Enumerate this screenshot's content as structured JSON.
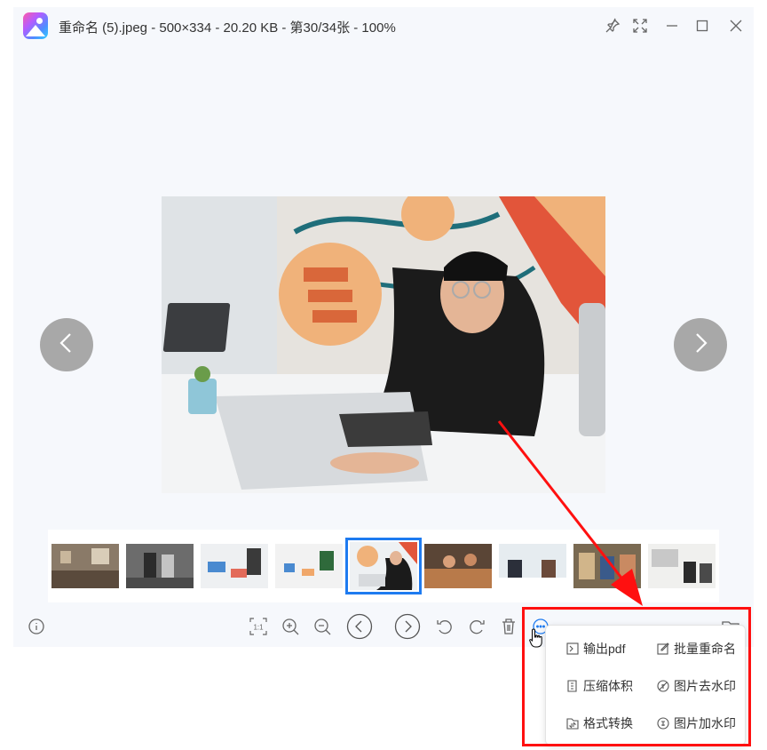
{
  "window": {
    "title": "重命名 (5).jpeg - 500×334 - 20.20 KB - 第30/34张 - 100%",
    "title_icons": [
      "pin-icon",
      "fullscreen-icon",
      "minimize-icon",
      "maximize-icon",
      "close-icon"
    ]
  },
  "viewer": {
    "prev_icon": "chevron-left-icon",
    "next_icon": "chevron-right-icon"
  },
  "thumbnails": {
    "count": 9,
    "selected_index": 4
  },
  "toolbar": {
    "icons": [
      "info-icon",
      "actual-size-icon",
      "zoom-in-icon",
      "zoom-out-icon",
      "previous-icon",
      "next-icon",
      "rotate-left-icon",
      "rotate-right-icon",
      "delete-icon",
      "more-icon",
      "folder-icon"
    ],
    "actual_size_label": "1:1"
  },
  "more_menu": {
    "items": [
      {
        "label": "输出pdf",
        "icon": "pdf-icon"
      },
      {
        "label": "批量重命名",
        "icon": "rename-icon"
      },
      {
        "label": "压缩体积",
        "icon": "compress-icon"
      },
      {
        "label": "图片去水印",
        "icon": "remove-watermark-icon"
      },
      {
        "label": "格式转换",
        "icon": "convert-icon"
      },
      {
        "label": "图片加水印",
        "icon": "add-watermark-icon"
      }
    ]
  },
  "colors": {
    "selection": "#1e7bf0",
    "annotation": "#ff1010",
    "window_bg": "#f6f8fc"
  }
}
